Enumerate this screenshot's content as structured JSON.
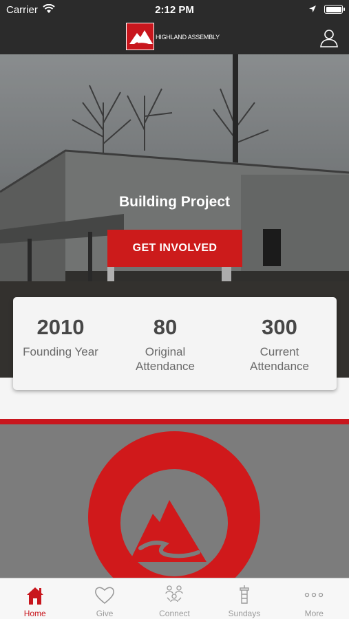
{
  "status_bar": {
    "carrier": "Carrier",
    "time": "2:12 PM"
  },
  "header": {
    "brand_name": "HIGHLAND ASSEMBLY",
    "profile_icon": "person-icon"
  },
  "hero": {
    "title": "Building Project",
    "cta_label": "GET INVOLVED"
  },
  "stats": [
    {
      "value": "2010",
      "label": "Founding Year"
    },
    {
      "value": "80",
      "label": "Original Attendance"
    },
    {
      "value": "300",
      "label": "Current Attendance"
    }
  ],
  "tabs": [
    {
      "label": "Home",
      "icon": "home-icon",
      "active": true
    },
    {
      "label": "Give",
      "icon": "heart-icon",
      "active": false
    },
    {
      "label": "Connect",
      "icon": "people-icon",
      "active": false
    },
    {
      "label": "Sundays",
      "icon": "pulpit-icon",
      "active": false
    },
    {
      "label": "More",
      "icon": "more-icon",
      "active": false
    }
  ],
  "colors": {
    "accent": "#c8161d",
    "nav_background": "#2b2b2b",
    "tab_inactive": "#9a9a9a"
  }
}
